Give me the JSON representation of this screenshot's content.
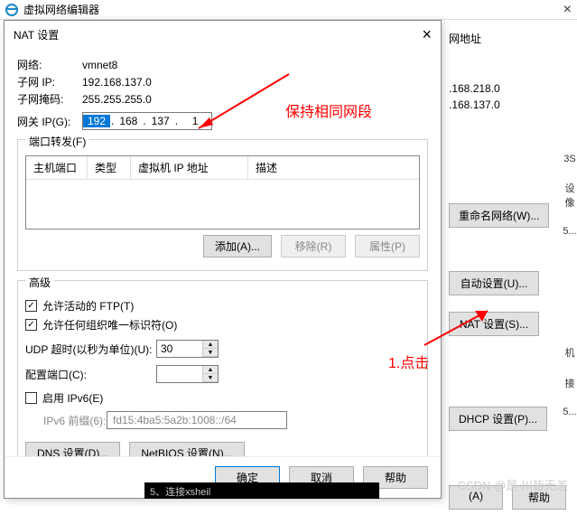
{
  "parent": {
    "title": "虚拟网络编辑器",
    "close": "×"
  },
  "bg": {
    "heading": "网地址",
    "ip1": ".168.218.0",
    "ip2": ".168.137.0",
    "rename_btn": "重命名网络(W)...",
    "auto_btn": "自动设置(U)...",
    "nat_btn": "NAT 设置(S)...",
    "dhcp_btn": "DHCP 设置(P)...",
    "apply_btn": "(A)",
    "help_btn": "帮助",
    "side_chars": {
      "a": "3S",
      "b": "设像",
      "c": "5...",
      "d": "机",
      "e": "接",
      "f": "5..."
    }
  },
  "dialog": {
    "title": "NAT 设置",
    "close": "×",
    "info": {
      "net_label": "网络:",
      "net": "vmnet8",
      "subnet_label": "子网 IP:",
      "subnet": "192.168.137.0",
      "mask_label": "子网掩码:",
      "mask": "255.255.255.0",
      "gw_label": "网关 IP(G):",
      "gw_parts": [
        "192",
        "168",
        "137",
        "1"
      ]
    },
    "port_fwd": {
      "title": "端口转发(F)",
      "cols": [
        "主机端口",
        "类型",
        "虚拟机 IP 地址",
        "描述"
      ],
      "add": "添加(A)...",
      "remove": "移除(R)",
      "props": "属性(P)"
    },
    "adv": {
      "title": "高级",
      "ftp": "允许活动的 FTP(T)",
      "org": "允许任何组织唯一标识符(O)",
      "udp_label": "UDP 超时(以秒为单位)(U):",
      "udp_val": "30",
      "port_label": "配置端口(C):",
      "port_val": "",
      "ipv6_chk": "启用 IPv6(E)",
      "ipv6_pre_label": "IPv6 前缀(6):",
      "ipv6_pre": "fd15:4ba5:5a2b:1008::/64",
      "dns_btn": "DNS 设置(D)...",
      "netbios_btn": "NetBIOS 设置(N)..."
    },
    "footer": {
      "ok": "确定",
      "cancel": "取消",
      "help": "帮助"
    }
  },
  "anno": {
    "red1": "保持相同网段",
    "red2": "1.点击"
  },
  "strip": "5、连接xsheil",
  "watermark": "CSDN @是 川皆无恙"
}
